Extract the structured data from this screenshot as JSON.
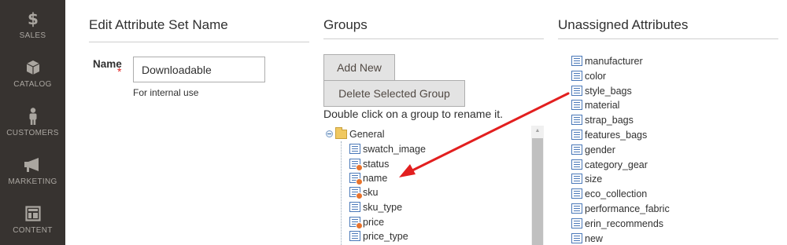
{
  "sidebar": {
    "items": [
      {
        "label": "SALES",
        "icon": "dollar-icon"
      },
      {
        "label": "CATALOG",
        "icon": "box-icon"
      },
      {
        "label": "CUSTOMERS",
        "icon": "person-icon"
      },
      {
        "label": "MARKETING",
        "icon": "megaphone-icon"
      },
      {
        "label": "CONTENT",
        "icon": "layout-icon"
      }
    ]
  },
  "edit_set": {
    "title": "Edit Attribute Set Name",
    "field_label": "Name",
    "required_mark": "*",
    "value": "Downloadable",
    "hint": "For internal use"
  },
  "groups": {
    "title": "Groups",
    "add_new_label": "Add New",
    "delete_label": "Delete Selected Group",
    "help": "Double click on a group to rename it.",
    "root": "General",
    "items": [
      {
        "label": "swatch_image",
        "system": false
      },
      {
        "label": "status",
        "system": true
      },
      {
        "label": "name",
        "system": true
      },
      {
        "label": "sku",
        "system": true
      },
      {
        "label": "sku_type",
        "system": false
      },
      {
        "label": "price",
        "system": true
      },
      {
        "label": "price_type",
        "system": false
      }
    ]
  },
  "unassigned": {
    "title": "Unassigned Attributes",
    "items": [
      "manufacturer",
      "color",
      "style_bags",
      "material",
      "strap_bags",
      "features_bags",
      "gender",
      "category_gear",
      "size",
      "eco_collection",
      "performance_fabric",
      "erin_recommends",
      "new"
    ]
  },
  "colors": {
    "sidebar_bg": "#373330",
    "annotation_arrow": "#e21f1f"
  }
}
